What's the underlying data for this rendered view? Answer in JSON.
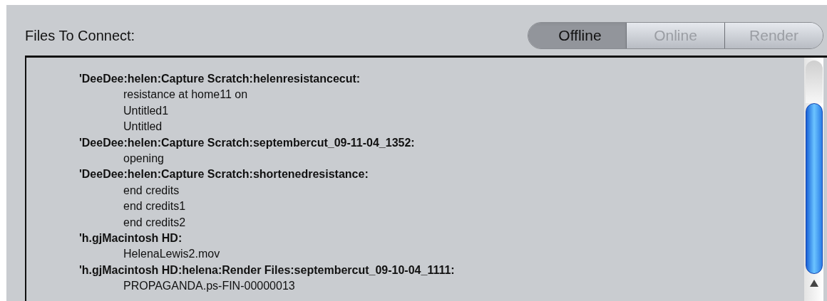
{
  "title": "Files To Connect:",
  "tabs": [
    {
      "label": "Offline",
      "selected": true
    },
    {
      "label": "Online",
      "selected": false
    },
    {
      "label": "Render",
      "selected": false
    }
  ],
  "rows": [
    {
      "kind": "folder",
      "text": "'DeeDee:helen:Capture Scratch:helenresistancecut:"
    },
    {
      "kind": "file",
      "text": "resistance at home11 on"
    },
    {
      "kind": "file",
      "text": "Untitled1"
    },
    {
      "kind": "file",
      "text": "Untitled"
    },
    {
      "kind": "folder",
      "text": "'DeeDee:helen:Capture Scratch:septembercut_09-11-04_1352:"
    },
    {
      "kind": "file",
      "text": "opening"
    },
    {
      "kind": "folder",
      "text": "'DeeDee:helen:Capture Scratch:shortenedresistance:"
    },
    {
      "kind": "file",
      "text": "end credits"
    },
    {
      "kind": "file",
      "text": "end credits1"
    },
    {
      "kind": "file",
      "text": "end credits2"
    },
    {
      "kind": "folder",
      "text": "'h.gjMacintosh HD:"
    },
    {
      "kind": "file",
      "text": "HelenaLewis2.mov"
    },
    {
      "kind": "folder",
      "text": "'h.gjMacintosh HD:helena:Render Files:septembercut_09-10-04_1111:"
    },
    {
      "kind": "file",
      "text": "PROPAGANDA.ps-FIN-00000013"
    }
  ]
}
